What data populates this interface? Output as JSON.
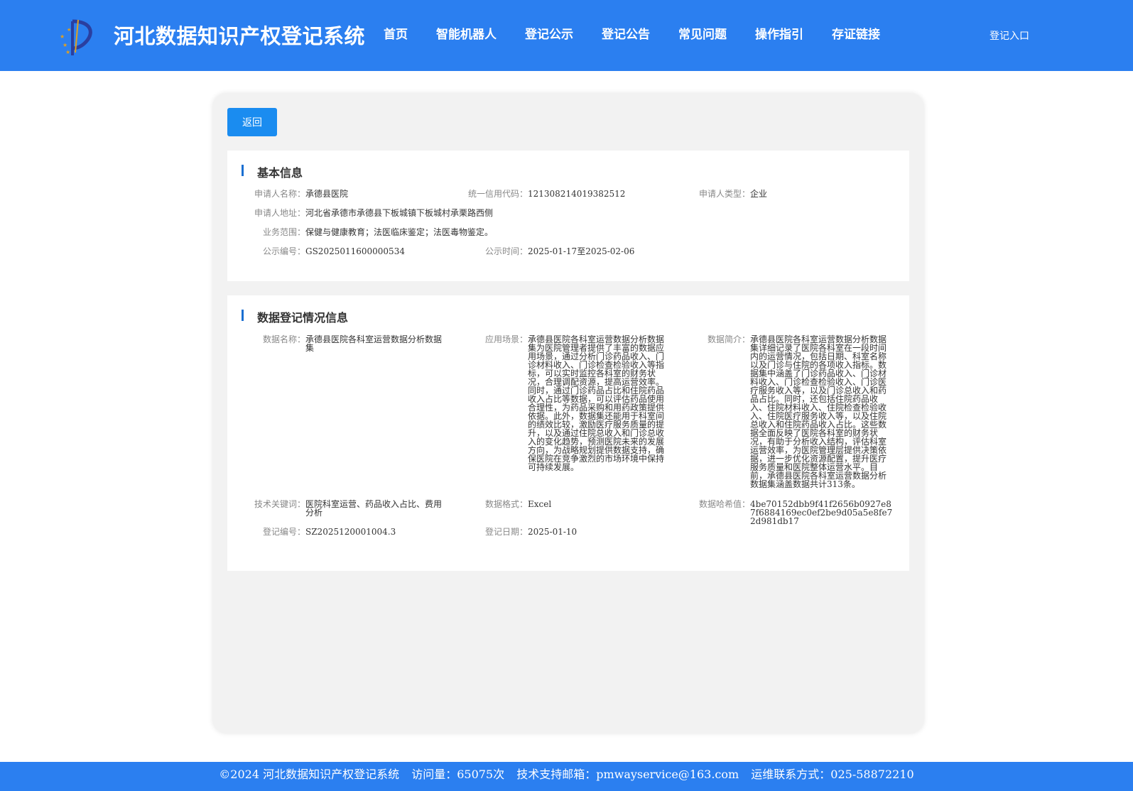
{
  "header": {
    "site_title": "河北数据知识产权登记系统",
    "nav": [
      "首页",
      "智能机器人",
      "登记公示",
      "登记公告",
      "常见问题",
      "操作指引",
      "存证链接"
    ],
    "login": "登记入口"
  },
  "back_label": "返回",
  "basic": {
    "title": "基本信息",
    "applicant_name_label": "申请人名称：",
    "applicant_name": "承德县医院",
    "credit_code_label": "统一信用代码：",
    "credit_code": "121308214019382512",
    "applicant_type_label": "申请人类型：",
    "applicant_type": "企业",
    "address_label": "申请人地址：",
    "address": "河北省承德市承德县下板城镇下板城村承栗路西侧",
    "scope_label": "业务范围：",
    "scope": "保健与健康教育；法医临床鉴定；法医毒物鉴定。",
    "notice_no_label": "公示编号：",
    "notice_no": "GS2025011600000534",
    "notice_time_label": "公示时间：",
    "notice_time": "2025-01-17至2025-02-06"
  },
  "registration": {
    "title": "数据登记情况信息",
    "data_name_label": "数据名称：",
    "data_name": "承德县医院各科室运营数据分析数据集",
    "scenario_label": "应用场景：",
    "scenario": "承德县医院各科室运营数据分析数据集为医院管理者提供了丰富的数据应用场景，通过分析门诊药品收入、门诊材料收入、门诊检查检验收入等指标，可以实时监控各科室的财务状况，合理调配资源，提高运营效率。同时，通过门诊药品占比和住院药品收入占比等数据，可以评估药品使用合理性，为药品采购和用药政策提供依据。此外，数据集还能用于科室间的绩效比较，激励医疗服务质量的提升，以及通过住院总收入和门诊总收入的变化趋势，预测医院未来的发展方向，为战略规划提供数据支持，确保医院在竞争激烈的市场环境中保持可持续发展。",
    "intro_label": "数据简介：",
    "intro": "承德县医院各科室运营数据分析数据集详细记录了医院各科室在一段时间内的运营情况，包括日期、科室名称以及门诊与住院的各项收入指标。数据集中涵盖了门诊药品收入、门诊材料收入、门诊检查检验收入、门诊医疗服务收入等，以及门诊总收入和药品占比。同时，还包括住院药品收入、住院材料收入、住院检查检验收入、住院医疗服务收入等，以及住院总收入和住院药品收入占比。这些数据全面反映了医院各科室的财务状况，有助于分析收入结构，评估科室运营效率，为医院管理层提供决策依据，进一步优化资源配置，提升医疗服务质量和医院整体运营水平。目前，承德县医院各科室运营数据分析数据集涵盖数据共计313条。",
    "keywords_label": "技术关键词：",
    "keywords": "医院科室运营、药品收入占比、费用分析",
    "format_label": "数据格式：",
    "format": "Excel",
    "hash_label": "数据哈希值：",
    "hash": "4be70152dbb9f41f2656b0927e87f6884169ec0ef2be9d05a5e8fe72d981db17",
    "reg_no_label": "登记编号：",
    "reg_no": "SZ2025120001004.3",
    "reg_date_label": "登记日期：",
    "reg_date": "2025-01-10"
  },
  "footer": {
    "copyright": "©2024 河北数据知识产权登记系统",
    "visits": "访问量：65075次",
    "email": "技术支持邮箱：pmwayservice@163.com",
    "contact": "运维联系方式：025-58872210"
  }
}
